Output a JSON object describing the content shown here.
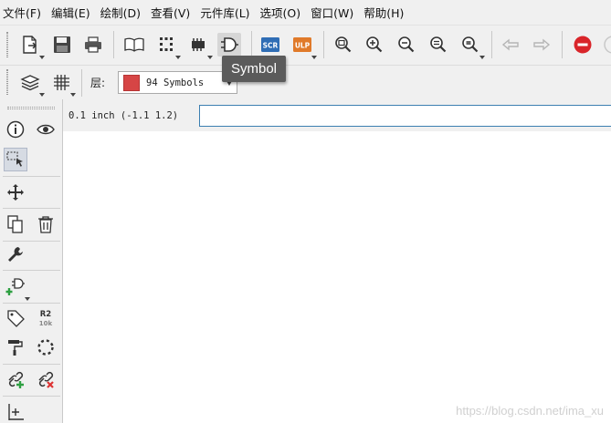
{
  "menu": {
    "items": [
      {
        "label": "文件(F)"
      },
      {
        "label": "编辑(E)"
      },
      {
        "label": "绘制(D)"
      },
      {
        "label": "查看(V)"
      },
      {
        "label": "元件库(L)"
      },
      {
        "label": "选项(O)"
      },
      {
        "label": "窗口(W)"
      },
      {
        "label": "帮助(H)"
      }
    ]
  },
  "toolbar": {
    "scr_label": "SCR",
    "ulp_label": "ULP",
    "tooltip": "Symbol"
  },
  "layer": {
    "label": "层:",
    "selected": "94 Symbols",
    "swatch_color": "#d64545"
  },
  "sidebar": {
    "r2_label": "R2",
    "r2_value": "10k"
  },
  "status": {
    "coordinates": "0.1 inch (-1.1 1.2)",
    "command_value": ""
  },
  "watermark": "https://blog.csdn.net/ima_xu",
  "colors": {
    "scr_bg": "#2f6db5",
    "ulp_bg": "#e07a2a",
    "stop_red": "#d9252a",
    "add_green": "#2ea042",
    "remove_red": "#d33",
    "input_border": "#3c7fb1"
  }
}
